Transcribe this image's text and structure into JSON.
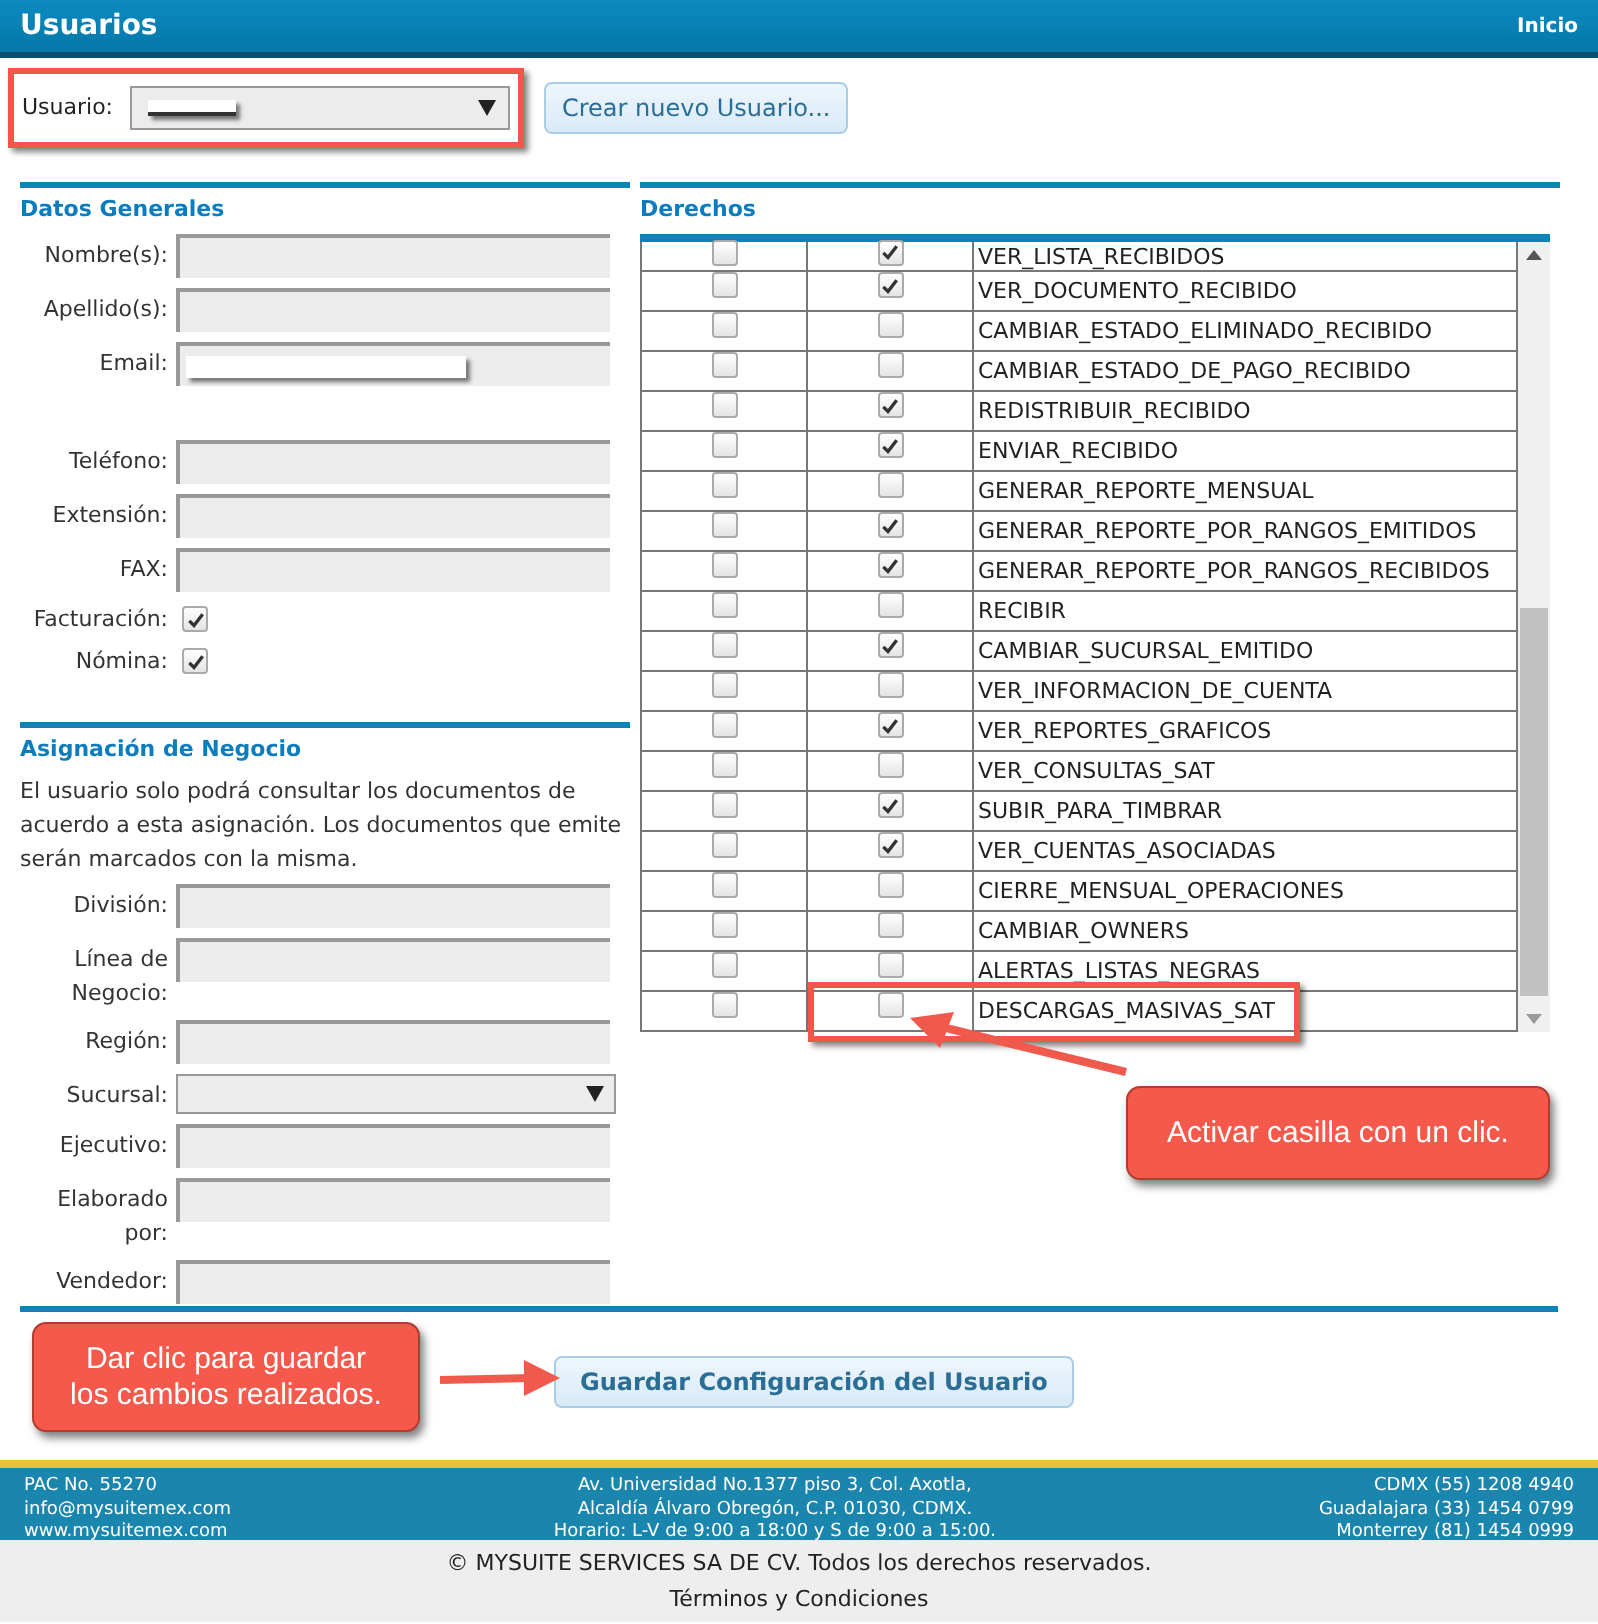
{
  "header": {
    "title": "Usuarios",
    "link": "Inicio"
  },
  "user_row": {
    "label": "Usuario:",
    "create_button": "Crear nuevo Usuario..."
  },
  "datos_generales": {
    "title": "Datos Generales",
    "field_groups": [
      [
        {
          "label": "Nombre(s):",
          "kind": "text"
        },
        {
          "label": "Apellido(s):",
          "kind": "text"
        },
        {
          "label": "Email:",
          "kind": "redacted"
        }
      ],
      [
        {
          "label": "Teléfono:",
          "kind": "text"
        },
        {
          "label": "Extensión:",
          "kind": "text"
        },
        {
          "label": "FAX:",
          "kind": "text"
        },
        {
          "label": "Facturación:",
          "kind": "checkbox",
          "checked": true
        },
        {
          "label": "Nómina:",
          "kind": "checkbox",
          "checked": true
        }
      ]
    ]
  },
  "asignacion": {
    "title": "Asignación de Negocio",
    "description": "El usuario solo podrá consultar los documentos de acuerdo a esta asignación. Los documentos que emite serán marcados con la misma.",
    "fields": [
      {
        "label": "División:",
        "kind": "text"
      },
      {
        "label": "Línea de Negocio:",
        "kind": "text"
      },
      {
        "label": "Región:",
        "kind": "text"
      },
      {
        "label": "Sucursal:",
        "kind": "select"
      },
      {
        "label": "Ejecutivo:",
        "kind": "text"
      },
      {
        "label": "Elaborado por:",
        "kind": "text"
      },
      {
        "label": "Vendedor:",
        "kind": "text"
      }
    ]
  },
  "derechos": {
    "title": "Derechos",
    "rows": [
      {
        "col_1": false,
        "col_2": true,
        "name": "VER_LISTA_RECIBIDOS"
      },
      {
        "col_1": false,
        "col_2": true,
        "name": "VER_DOCUMENTO_RECIBIDO"
      },
      {
        "col_1": false,
        "col_2": false,
        "name": "CAMBIAR_ESTADO_ELIMINADO_RECIBIDO"
      },
      {
        "col_1": false,
        "col_2": false,
        "name": "CAMBIAR_ESTADO_DE_PAGO_RECIBIDO"
      },
      {
        "col_1": false,
        "col_2": true,
        "name": "REDISTRIBUIR_RECIBIDO"
      },
      {
        "col_1": false,
        "col_2": true,
        "name": "ENVIAR_RECIBIDO"
      },
      {
        "col_1": false,
        "col_2": false,
        "name": "GENERAR_REPORTE_MENSUAL"
      },
      {
        "col_1": false,
        "col_2": true,
        "name": "GENERAR_REPORTE_POR_RANGOS_EMITIDOS"
      },
      {
        "col_1": false,
        "col_2": true,
        "name": "GENERAR_REPORTE_POR_RANGOS_RECIBIDOS"
      },
      {
        "col_1": false,
        "col_2": false,
        "name": "RECIBIR"
      },
      {
        "col_1": false,
        "col_2": true,
        "name": "CAMBIAR_SUCURSAL_EMITIDO"
      },
      {
        "col_1": false,
        "col_2": false,
        "name": "VER_INFORMACION_DE_CUENTA"
      },
      {
        "col_1": false,
        "col_2": true,
        "name": "VER_REPORTES_GRAFICOS"
      },
      {
        "col_1": false,
        "col_2": false,
        "name": "VER_CONSULTAS_SAT"
      },
      {
        "col_1": false,
        "col_2": true,
        "name": "SUBIR_PARA_TIMBRAR"
      },
      {
        "col_1": false,
        "col_2": true,
        "name": "VER_CUENTAS_ASOCIADAS"
      },
      {
        "col_1": false,
        "col_2": false,
        "name": "CIERRE_MENSUAL_OPERACIONES"
      },
      {
        "col_1": false,
        "col_2": false,
        "name": "CAMBIAR_OWNERS"
      },
      {
        "col_1": false,
        "col_2": false,
        "name": "ALERTAS_LISTAS_NEGRAS"
      },
      {
        "col_1": false,
        "col_2": false,
        "name": "DESCARGAS_MASIVAS_SAT"
      }
    ]
  },
  "save_button": "Guardar Configuración del Usuario",
  "annotations": [
    {
      "kind": "rights",
      "text": "Activar casilla con un clic."
    },
    {
      "kind": "save",
      "text": "Dar clic para guardar los cambios realizados."
    }
  ],
  "footer": {
    "left": [
      "PAC No. 55270",
      "info@mysuitemex.com",
      "www.mysuitemex.com"
    ],
    "center": [
      "Av. Universidad No.1377 piso 3, Col. Axotla,",
      "Alcaldía Álvaro Obregón, C.P. 01030, CDMX.",
      "Horario: L-V de 9:00 a 18:00 y S de 9:00 a 15:00."
    ],
    "right": [
      "CDMX (55) 1208 4940",
      "Guadalajara (33) 1454 0799",
      "Monterrey (81) 1454 0999"
    ],
    "copyright": "© MYSUITE SERVICES SA DE CV. Todos los derechos reservados.",
    "terms": "Términos y Condiciones"
  }
}
